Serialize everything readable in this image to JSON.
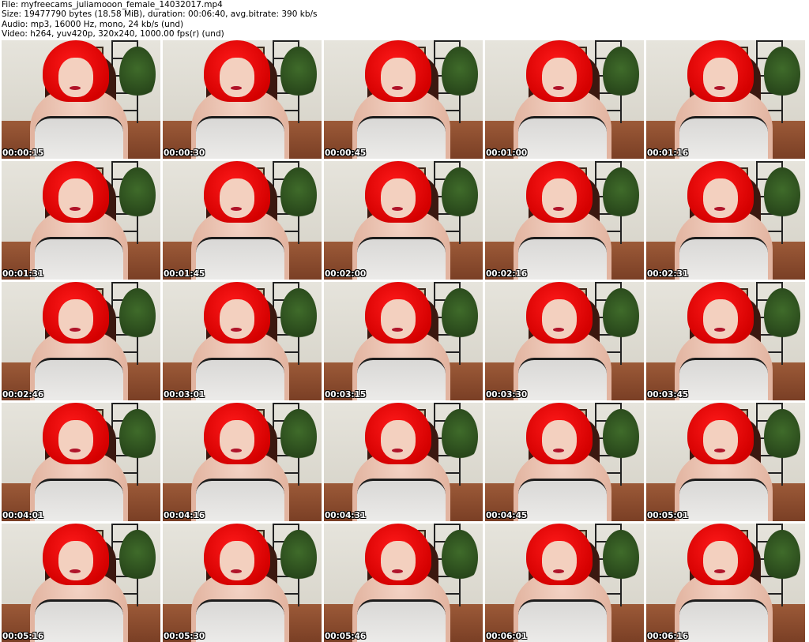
{
  "header": {
    "file_line": "File: myfreecams_juliamooon_female_14032017.mp4",
    "size_line": "Size: 19477790 bytes (18.58 MiB), duration: 00:06:40, avg.bitrate: 390 kb/s",
    "audio_line": "Audio: mp3, 16000 Hz, mono, 24 kb/s (und)",
    "video_line": "Video: h264, yuv420p, 320x240, 1000.00 fps(r) (und)"
  },
  "thumbnails": [
    {
      "timestamp": "00:00:15"
    },
    {
      "timestamp": "00:00:30"
    },
    {
      "timestamp": "00:00:45"
    },
    {
      "timestamp": "00:01:00"
    },
    {
      "timestamp": "00:01:16"
    },
    {
      "timestamp": "00:01:31"
    },
    {
      "timestamp": "00:01:45"
    },
    {
      "timestamp": "00:02:00"
    },
    {
      "timestamp": "00:02:16"
    },
    {
      "timestamp": "00:02:31"
    },
    {
      "timestamp": "00:02:46"
    },
    {
      "timestamp": "00:03:01"
    },
    {
      "timestamp": "00:03:15"
    },
    {
      "timestamp": "00:03:30"
    },
    {
      "timestamp": "00:03:45"
    },
    {
      "timestamp": "00:04:01"
    },
    {
      "timestamp": "00:04:16"
    },
    {
      "timestamp": "00:04:31"
    },
    {
      "timestamp": "00:04:45"
    },
    {
      "timestamp": "00:05:01"
    },
    {
      "timestamp": "00:05:16"
    },
    {
      "timestamp": "00:05:30"
    },
    {
      "timestamp": "00:05:46"
    },
    {
      "timestamp": "00:06:01"
    },
    {
      "timestamp": "00:06:16"
    }
  ]
}
